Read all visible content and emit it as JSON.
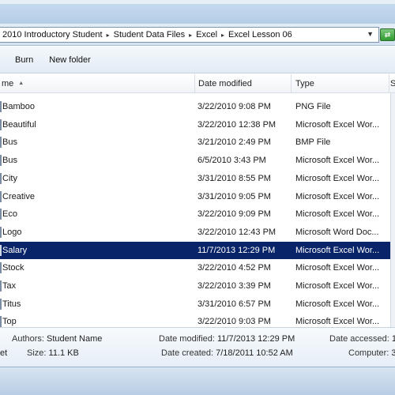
{
  "address": {
    "crumbs": [
      "2010 Introductory Student",
      "Student Data Files",
      "Excel",
      "Excel Lesson 06"
    ],
    "separator": "▸",
    "dropdown": "▼",
    "go": "⇄"
  },
  "toolbar": {
    "burn": "Burn",
    "new_folder": "New folder"
  },
  "columns": {
    "name": "me",
    "date": "Date modified",
    "type": "Type",
    "size": "S"
  },
  "files": [
    {
      "name": "Bamboo",
      "date": "3/22/2010 9:08 PM",
      "type": "PNG File",
      "selected": false
    },
    {
      "name": "Beautiful",
      "date": "3/22/2010 12:38 PM",
      "type": "Microsoft Excel Wor...",
      "selected": false
    },
    {
      "name": "Bus",
      "date": "3/21/2010 2:49 PM",
      "type": "BMP File",
      "selected": false
    },
    {
      "name": "Bus",
      "date": "6/5/2010 3:43 PM",
      "type": "Microsoft Excel Wor...",
      "selected": false
    },
    {
      "name": "City",
      "date": "3/31/2010 8:55 PM",
      "type": "Microsoft Excel Wor...",
      "selected": false
    },
    {
      "name": "Creative",
      "date": "3/31/2010 9:05 PM",
      "type": "Microsoft Excel Wor...",
      "selected": false
    },
    {
      "name": "Eco",
      "date": "3/22/2010 9:09 PM",
      "type": "Microsoft Excel Wor...",
      "selected": false
    },
    {
      "name": "Logo",
      "date": "3/22/2010 12:43 PM",
      "type": "Microsoft Word Doc...",
      "selected": false
    },
    {
      "name": "Salary",
      "date": "11/7/2013 12:29 PM",
      "type": "Microsoft Excel Wor...",
      "selected": true
    },
    {
      "name": "Stock",
      "date": "3/22/2010 4:52 PM",
      "type": "Microsoft Excel Wor...",
      "selected": false
    },
    {
      "name": "Tax",
      "date": "3/22/2010 3:39 PM",
      "type": "Microsoft Excel Wor...",
      "selected": false
    },
    {
      "name": "Titus",
      "date": "3/31/2010 6:57 PM",
      "type": "Microsoft Excel Wor...",
      "selected": false
    },
    {
      "name": "Top",
      "date": "3/22/2010 9:03 PM",
      "type": "Microsoft Excel Wor...",
      "selected": false
    }
  ],
  "details": {
    "authors_label": "Authors:",
    "authors_value": "Student Name",
    "date_modified_label": "Date modified:",
    "date_modified_value": "11/7/2013 12:29 PM",
    "date_accessed_label": "Date accessed:",
    "date_accessed_value": "1",
    "type_fragment": "et",
    "size_label": "Size:",
    "size_value": "11.1 KB",
    "date_created_label": "Date created:",
    "date_created_value": "7/18/2011 10:52 AM",
    "computer_label": "Computer:",
    "computer_value": "3"
  },
  "colors": {
    "selection": "#0a246a",
    "selection_text": "#ffffff"
  }
}
